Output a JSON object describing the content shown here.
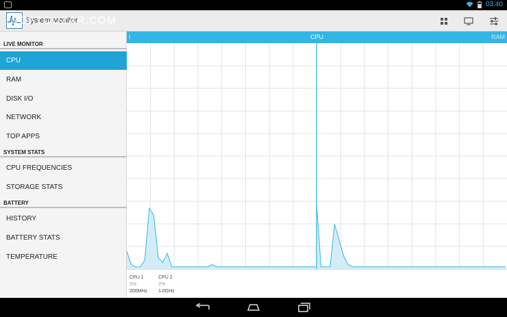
{
  "status_bar": {
    "time": "03:40"
  },
  "app": {
    "title": "System Monitor",
    "watermark": "SOFTCOZAR.COM"
  },
  "sidebar": {
    "sections": [
      {
        "header": "LIVE MONITOR",
        "items": [
          "CPU",
          "RAM",
          "DISK I/O",
          "NETWORK",
          "TOP APPS"
        ]
      },
      {
        "header": "SYSTEM STATS",
        "items": [
          "CPU FREQUENCIES",
          "STORAGE STATS"
        ]
      },
      {
        "header": "BATTERY",
        "items": [
          "HISTORY",
          "BATTERY STATS",
          "TEMPERATURE"
        ]
      }
    ],
    "active_item": "CPU"
  },
  "graph": {
    "tabs": {
      "left": "I",
      "center": "CPU",
      "right": "RAM"
    },
    "accent_color": "#33b5e5",
    "fill_color": "#d3edf8",
    "cores": [
      {
        "name": "CPU 1",
        "usage": "0%",
        "freq": "200MHz"
      },
      {
        "name": "CPU 2",
        "usage": "2%",
        "freq": "1.0GHz"
      }
    ],
    "usage_series": [
      [
        8,
        2,
        1,
        1,
        4,
        27,
        24,
        5,
        3,
        7,
        1,
        1,
        1,
        1,
        1,
        1,
        1,
        1,
        1,
        2,
        1,
        1,
        1,
        1,
        1,
        1,
        1,
        1,
        1,
        1,
        1,
        1,
        1,
        1,
        1,
        1,
        1,
        1,
        1,
        1,
        1,
        1,
        1
      ],
      [
        29,
        1,
        1,
        1,
        20,
        13,
        6,
        2,
        1,
        1,
        1,
        1,
        1,
        1,
        1,
        1,
        1,
        1,
        1,
        1,
        1,
        1,
        1,
        1,
        1,
        1,
        1,
        1,
        1,
        1,
        1,
        1,
        1,
        1,
        1,
        1,
        1,
        1,
        1,
        1,
        1,
        1,
        1
      ]
    ]
  }
}
